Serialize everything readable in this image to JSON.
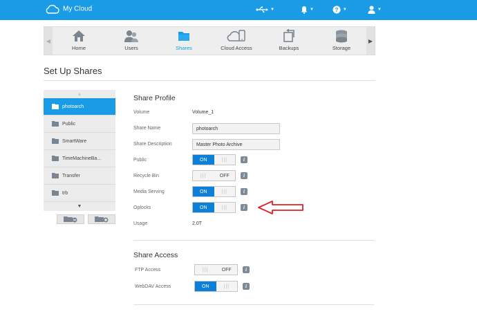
{
  "app": {
    "brand": "My Cloud",
    "trademark": "˙"
  },
  "topbar": {
    "usb_icon": "usb-icon",
    "bell_icon": "bell-icon",
    "help_icon": "help-icon",
    "user_icon": "user-icon"
  },
  "nav": {
    "items": [
      {
        "label": "Home",
        "icon": "home-icon"
      },
      {
        "label": "Users",
        "icon": "users-icon"
      },
      {
        "label": "Shares",
        "icon": "folder-icon",
        "active": true
      },
      {
        "label": "Cloud Access",
        "icon": "cloud-access-icon"
      },
      {
        "label": "Backups",
        "icon": "backup-icon"
      },
      {
        "label": "Storage",
        "icon": "storage-icon"
      }
    ]
  },
  "page": {
    "title": "Set Up Shares"
  },
  "shares": {
    "items": [
      "photoarch",
      "Public",
      "SmartWare",
      "TimeMachineBa...",
      "Transfer",
      "trb"
    ],
    "selected": "photoarch"
  },
  "profile": {
    "title": "Share Profile",
    "volume_label": "Volume",
    "volume_value": "Volume_1",
    "share_name_label": "Share Name",
    "share_name_value": "photoarch",
    "share_desc_label": "Share Description",
    "share_desc_value": "Master Photo Archive",
    "public_label": "Public",
    "public_state": "ON",
    "recycle_label": "Recycle Bin",
    "recycle_state": "OFF",
    "media_label": "Media Serving",
    "media_state": "ON",
    "oplocks_label": "Oplocks",
    "oplocks_state": "ON",
    "usage_label": "Usage",
    "usage_value": "2.0T"
  },
  "access": {
    "title": "Share Access",
    "ftp_label": "FTP Access",
    "ftp_state": "OFF",
    "webdav_label": "WebDAV Access",
    "webdav_state": "ON"
  },
  "toggle": {
    "on": "ON",
    "off": "OFF",
    "grip": "|||"
  },
  "info_glyph": "i",
  "colors": {
    "accent": "#1a9be6",
    "toggle_on": "#0c7fd9",
    "annotation": "#e02020"
  }
}
